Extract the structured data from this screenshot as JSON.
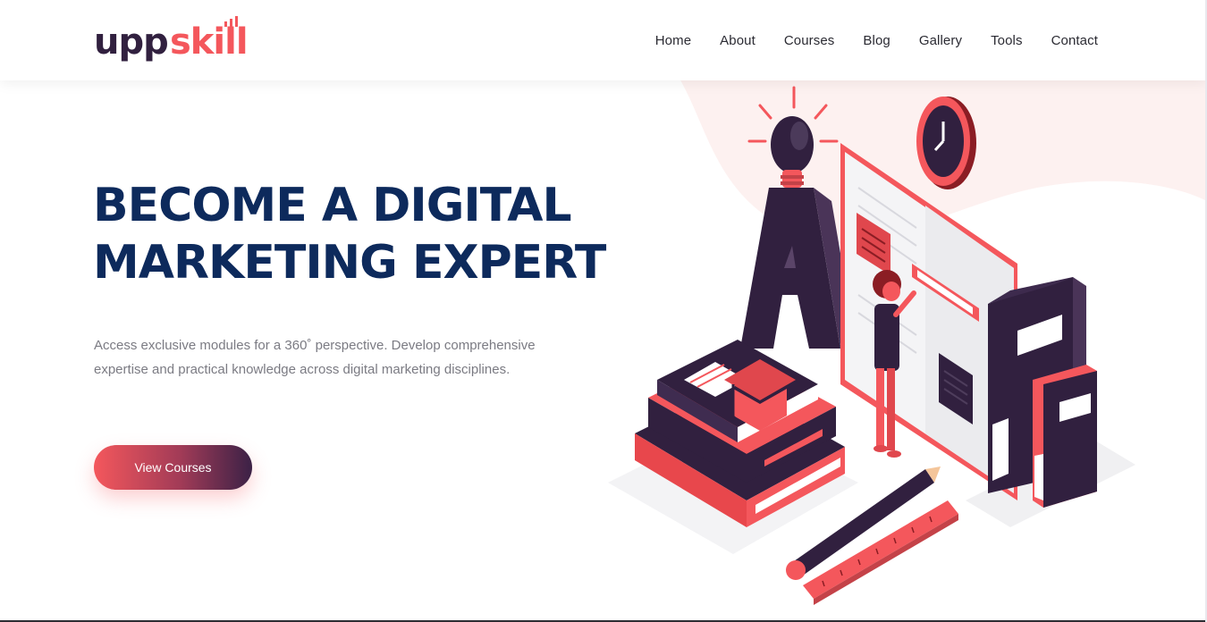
{
  "brand": {
    "logo_dark_text": "upp",
    "logo_accent_text": "skill",
    "primary_color": "#0d2a5c",
    "accent_color": "#f4575c",
    "dark_purple": "#31203f"
  },
  "nav": {
    "items": [
      {
        "label": "Home"
      },
      {
        "label": "About"
      },
      {
        "label": "Courses"
      },
      {
        "label": "Blog"
      },
      {
        "label": "Gallery"
      },
      {
        "label": "Tools"
      },
      {
        "label": "Contact"
      }
    ]
  },
  "hero": {
    "title_line1": "BECOME A DIGITAL",
    "title_line2": "MARKETING EXPERT",
    "description": "Access exclusive modules for a 360˚ perspective. Develop comprehensive expertise and practical knowledge across digital marketing disciplines.",
    "cta_label": "View Courses"
  },
  "illustration": {
    "icons": [
      "lightbulb-icon",
      "clock-icon",
      "graduation-cap-icon",
      "pencil-icon",
      "ruler-icon",
      "books-icon",
      "binders-icon",
      "letter-a-icon",
      "person-icon",
      "open-book-icon"
    ]
  }
}
